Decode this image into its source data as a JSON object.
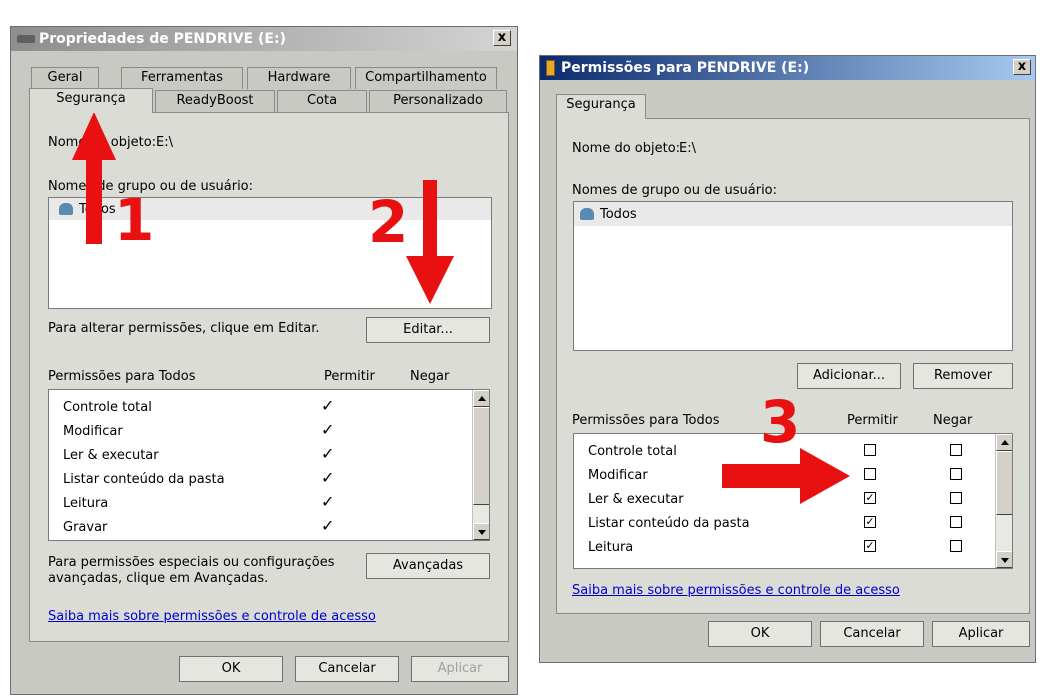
{
  "left_dialog": {
    "title": "Propriedades de PENDRIVE (E:)",
    "close": "x",
    "tabs_row1": [
      "Geral",
      "Ferramentas",
      "Hardware",
      "Compartilhamento"
    ],
    "tabs_row2": [
      "Segurança",
      "ReadyBoost",
      "Cota",
      "Personalizado"
    ],
    "object_name_label": "Nome do objeto:",
    "object_name_value": "E:\\",
    "group_label": "Nomes de grupo ou de usuário:",
    "group_items": [
      "Todos"
    ],
    "change_text": "Para alterar permissões, clique em Editar.",
    "edit_button": "Editar...",
    "perm_header": "Permissões para Todos",
    "col_allow": "Permitir",
    "col_deny": "Negar",
    "permissions": [
      {
        "name": "Controle total",
        "allow": true,
        "deny": false
      },
      {
        "name": "Modificar",
        "allow": true,
        "deny": false
      },
      {
        "name": "Ler & executar",
        "allow": true,
        "deny": false
      },
      {
        "name": "Listar conteúdo da pasta",
        "allow": true,
        "deny": false
      },
      {
        "name": "Leitura",
        "allow": true,
        "deny": false
      },
      {
        "name": "Gravar",
        "allow": true,
        "deny": false
      }
    ],
    "special_text_1": "Para permissões especiais ou configurações",
    "special_text_2": "avançadas, clique em Avançadas.",
    "advanced_button": "Avançadas",
    "learn_link": "Saiba mais sobre permissões e controle de acesso",
    "ok": "OK",
    "cancel": "Cancelar",
    "apply": "Aplicar"
  },
  "right_dialog": {
    "title": "Permissões para PENDRIVE (E:)",
    "close": "x",
    "tab": "Segurança",
    "object_name_label": "Nome do objeto:",
    "object_name_value": "E:\\",
    "group_label": "Nomes de grupo ou de usuário:",
    "group_items": [
      "Todos"
    ],
    "add_button": "Adicionar...",
    "remove_button": "Remover",
    "perm_header": "Permissões para Todos",
    "col_allow": "Permitir",
    "col_deny": "Negar",
    "permissions": [
      {
        "name": "Controle total",
        "allow": false,
        "deny": false
      },
      {
        "name": "Modificar",
        "allow": false,
        "deny": false
      },
      {
        "name": "Ler & executar",
        "allow": true,
        "deny": false
      },
      {
        "name": "Listar conteúdo da pasta",
        "allow": true,
        "deny": false
      },
      {
        "name": "Leitura",
        "allow": true,
        "deny": false
      }
    ],
    "learn_link": "Saiba mais sobre permissões e controle de acesso",
    "ok": "OK",
    "cancel": "Cancelar",
    "apply": "Aplicar"
  },
  "annotations": {
    "step1": "1",
    "step2": "2",
    "step3": "3",
    "color": "#e81010"
  },
  "icons": {
    "check": "✓",
    "checkbox_checked": "☑",
    "users_icon": "users-icon",
    "drive_icon": "usb-drive-icon",
    "folder_icon": "folder-icon"
  }
}
